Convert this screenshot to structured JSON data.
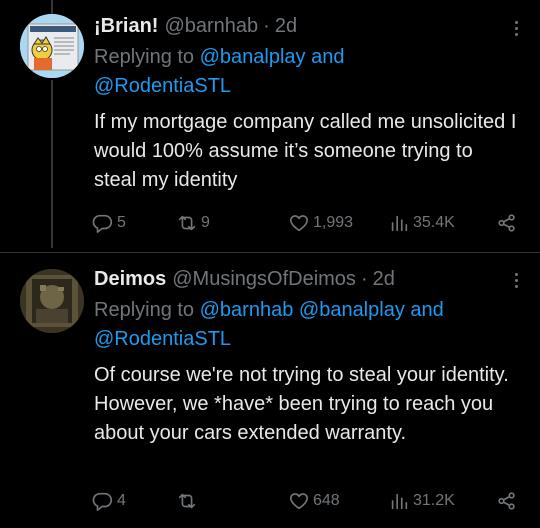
{
  "tweets": [
    {
      "name": "¡Brian!",
      "handle": "@barnhab",
      "dot": "·",
      "time": "2d",
      "replying_prefix": "Replying to",
      "replying_links": [
        "@banalplay",
        "and",
        "@RodentiaSTL"
      ],
      "text": "If my mortgage company called me unsolicited I would 100% assume it’s someone trying to steal my identity",
      "replies": "5",
      "retweets": "9",
      "likes": "1,993",
      "views": "35.4K",
      "avatar_icon": "cartoon-newspaper-avatar"
    },
    {
      "name": "Deimos",
      "handle": "@MusingsOfDeimos",
      "dot": "·",
      "time": "2d",
      "replying_prefix": "Replying to",
      "replying_links": [
        "@barnhab",
        "@banalplay",
        "and",
        "@RodentiaSTL"
      ],
      "text": "Of course we're not trying to steal your identity. However, we *have* been trying to reach you about your cars extended warranty.",
      "replies": "4",
      "retweets": "",
      "likes": "648",
      "views": "31.2K",
      "avatar_icon": "dark-photo-avatar"
    }
  ],
  "colors": {
    "background": "#000000",
    "text": "#e7e9ea",
    "muted": "#71767b",
    "link": "#1d9bf0",
    "divider": "#2f3336"
  }
}
